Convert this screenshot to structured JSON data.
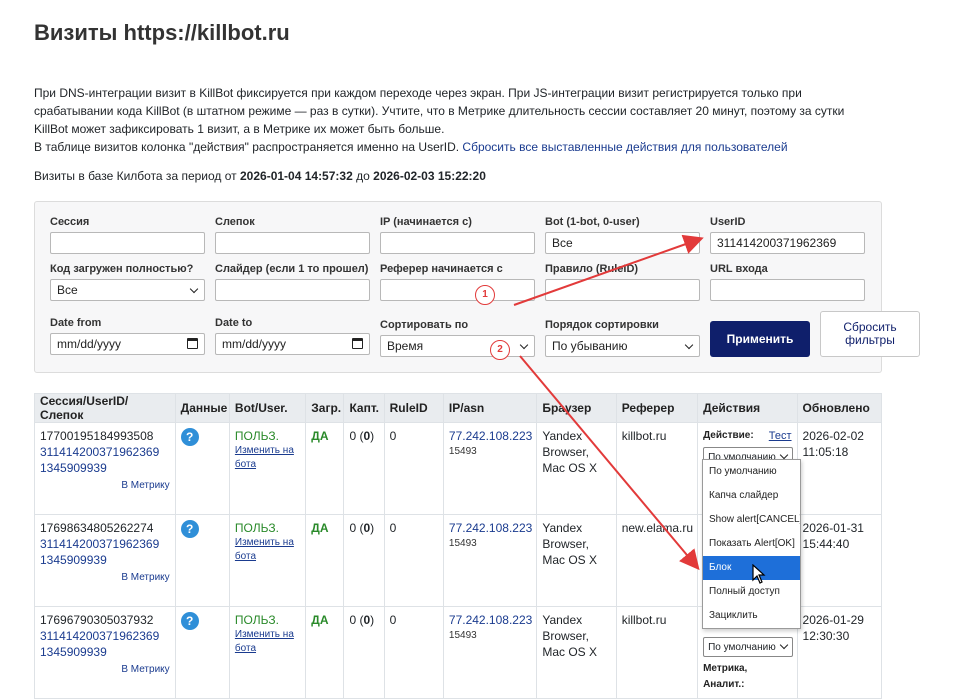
{
  "page": {
    "title": "Визиты https://killbot.ru",
    "intro_line1": "При DNS-интеграции визит в KillBot фиксируется при каждом переходе через экран. При JS-интеграции визит регистрируется только при",
    "intro_line2": "срабатывании кода KillBot (в штатном режиме — раз в сутки). Учтите, что в Метрике длительность сессии составляет 20 минут, поэтому за сутки",
    "intro_line3": "KillBot может зафиксировать 1 визит, а в Метрике их может быть больше.",
    "intro_line4": "В таблице визитов колонка \"действия\" распространяется именно на UserID.",
    "reset_actions_link": "Сбросить все выставленные действия для пользователей",
    "period_prefix": "Визиты в базе Килбота за период от",
    "period_from": "2026-01-04 14:57:32",
    "period_mid": "до",
    "period_to": "2026-02-03 15:22:20"
  },
  "filters": {
    "session_label": "Сессия",
    "session_value": "",
    "cast_label": "Слепок",
    "cast_value": "",
    "ip_label": "IP (начинается с)",
    "ip_value": "",
    "bot_label": "Bot (1-bot, 0-user)",
    "bot_value": "Все",
    "userid_label": "UserID",
    "userid_value": "311414200371962369",
    "code_label": "Код загружен полностью?",
    "code_value": "Все",
    "slider_label": "Слайдер (если 1 то прошел)",
    "slider_value": "",
    "referer_label": "Реферер начинается с",
    "referer_value": "",
    "rule_label": "Правило (RuleID)",
    "rule_value": "",
    "url_label": "URL входа",
    "url_value": "",
    "date_from_label": "Date from",
    "date_from_value": "mm/dd/yyyy",
    "date_to_label": "Date to",
    "date_to_value": "mm/dd/yyyy",
    "sort_label": "Сортировать по",
    "sort_value": "Время",
    "order_label": "Порядок сортировки",
    "order_value": "По убыванию",
    "apply_label": "Применить",
    "reset_label": "Сбросить фильтры"
  },
  "table": {
    "headers": [
      "Сессия/UserID/Слепок",
      "Данные",
      "Bot/User.",
      "Загр.",
      "Капт.",
      "RuleID",
      "IP/asn",
      "Браузер",
      "Реферер",
      "Действия",
      "Обновлено"
    ],
    "rows": [
      {
        "session": "17700195184993508",
        "userid": "311414200371962369",
        "cast": "1345909939",
        "metrika": "В Метрику",
        "data_icon": "?",
        "bot": "ПОЛЬЗ.",
        "bot_change": "Изменить на бота",
        "loaded": "ДА",
        "capt_pre": "0 (",
        "capt_bold": "0",
        "capt_post": ")",
        "rule": "0",
        "ip": "77.242.108.223",
        "asn": "15493",
        "browser": "Yandex Browser, Mac OS X",
        "referer": "killbot.ru",
        "action_label": "Действие:",
        "action_test": "Тест",
        "action_value": "По умолчанию",
        "updated": "2026-02-02 11:05:18"
      },
      {
        "session": "17698634805262274",
        "userid": "311414200371962369",
        "cast": "1345909939",
        "metrika": "В Метрику",
        "data_icon": "?",
        "bot": "ПОЛЬЗ.",
        "bot_change": "Изменить на бота",
        "loaded": "ДА",
        "capt_pre": "0 (",
        "capt_bold": "0",
        "capt_post": ")",
        "rule": "0",
        "ip": "77.242.108.223",
        "asn": "15493",
        "browser": "Yandex Browser, Mac OS X",
        "referer": "new.elama.ru",
        "action_label": "",
        "action_test": "",
        "action_value": "",
        "updated": "2026-01-31 15:44:40"
      },
      {
        "session": "17696790305037932",
        "userid": "311414200371962369",
        "cast": "1345909939",
        "metrika": "В Метрику",
        "data_icon": "?",
        "bot": "ПОЛЬЗ.",
        "bot_change": "Изменить на бота",
        "loaded": "ДА",
        "capt_pre": "0 (",
        "capt_bold": "0",
        "capt_post": ")",
        "rule": "0",
        "ip": "77.242.108.223",
        "asn": "15493",
        "browser": "Yandex Browser, Mac OS X",
        "referer": "killbot.ru",
        "action_label": "",
        "action_test": "",
        "action_value": "По умолчанию",
        "metrika_analit": "Метрика, Аналит.:",
        "updated": "2026-01-29 12:30:30"
      }
    ]
  },
  "dropdown": {
    "options": [
      "По умолчанию",
      "Капча слайдер",
      "Show alert[CANCEL]",
      "Показать Alert[OK]",
      "Блок",
      "Полный доступ",
      "Зациклить"
    ],
    "highlighted": "Блок"
  },
  "annotations": {
    "badge1": "1",
    "badge2": "2",
    "arrow_color": "#e23a3a"
  }
}
